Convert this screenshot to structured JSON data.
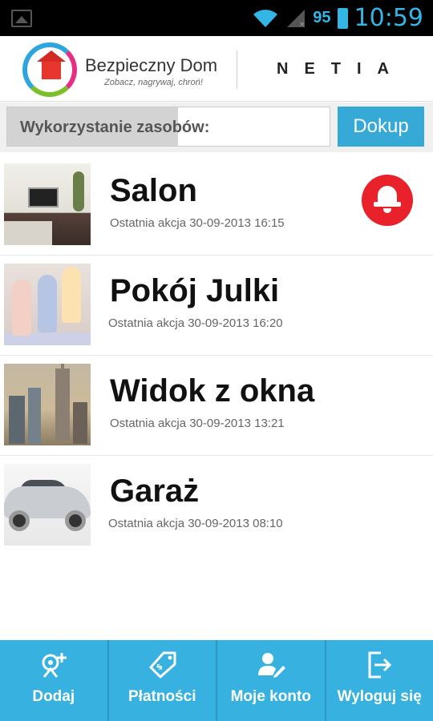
{
  "status_bar": {
    "battery": "95",
    "time": "10:59"
  },
  "header": {
    "brand_title": "Bezpieczny Dom",
    "brand_subtitle": "Zobacz, nagrywaj, chroń!",
    "partner": "NETIA"
  },
  "resources": {
    "label": "Wykorzystanie zasobów:",
    "usage_fraction": 0.53,
    "button_label": "Dokup"
  },
  "cameras": [
    {
      "name": "Salon",
      "last_action": "Ostatnia akcja 30-09-2013 16:15",
      "alarm": true,
      "thumb": "living-room"
    },
    {
      "name": "Pokój Julki",
      "last_action": "Ostatnia akcja 30-09-2013 16:20",
      "alarm": false,
      "thumb": "kids-room"
    },
    {
      "name": "Widok z okna",
      "last_action": "Ostatnia akcja 30-09-2013 13:21",
      "alarm": false,
      "thumb": "city-view"
    },
    {
      "name": "Garaż",
      "last_action": "Ostatnia akcja 30-09-2013 08:10",
      "alarm": false,
      "thumb": "car"
    }
  ],
  "bottom_nav": [
    {
      "label": "Dodaj",
      "icon": "add-camera-icon"
    },
    {
      "label": "Płatności",
      "icon": "price-tag-icon"
    },
    {
      "label": "Moje konto",
      "icon": "user-edit-icon"
    },
    {
      "label": "Wyloguj się",
      "icon": "logout-icon"
    }
  ],
  "colors": {
    "accent": "#36b1e0",
    "alarm": "#e8212b",
    "status_text": "#33b5e5"
  }
}
